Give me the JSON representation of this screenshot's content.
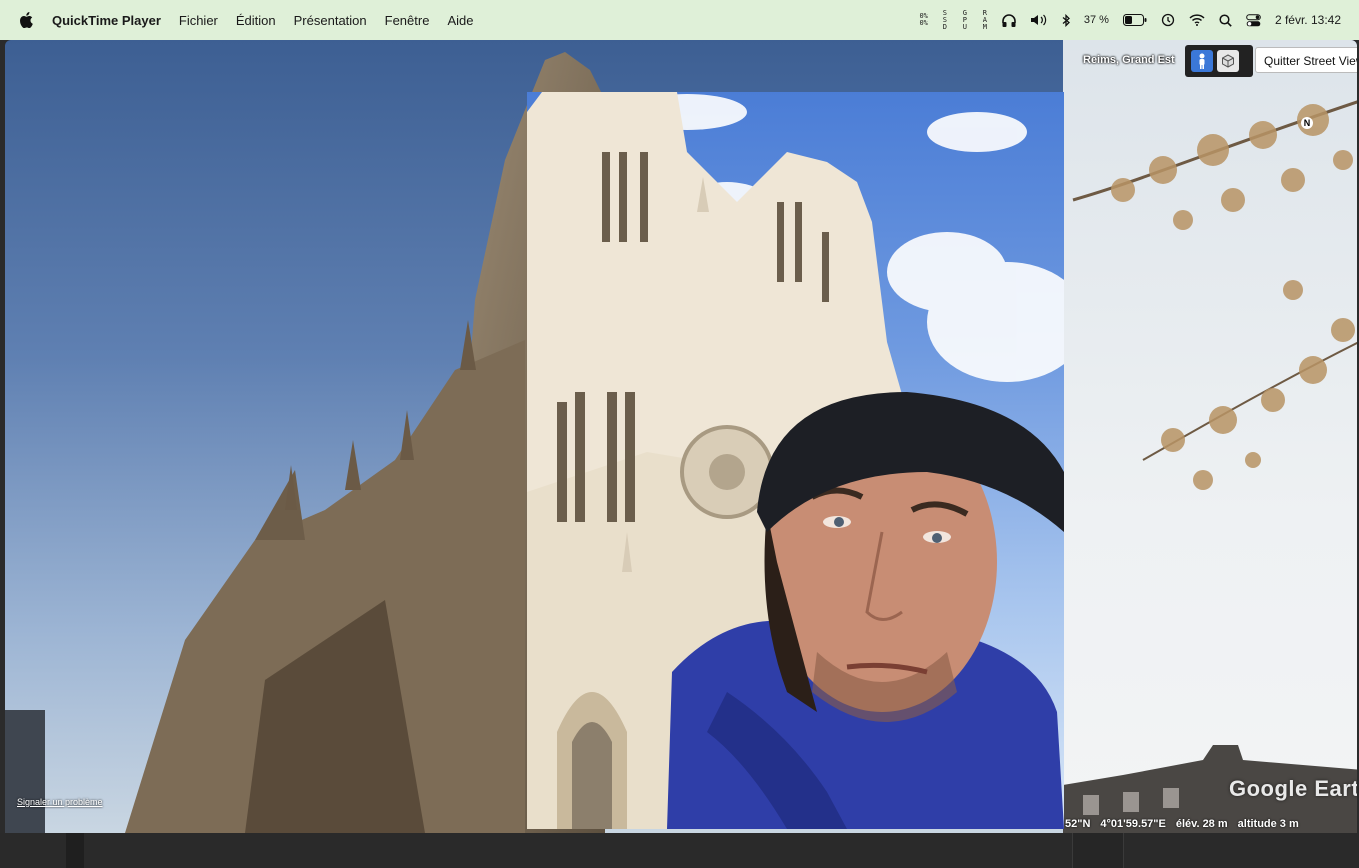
{
  "menubar": {
    "app_name": "QuickTime Player",
    "menus": [
      "Fichier",
      "Édition",
      "Présentation",
      "Fenêtre",
      "Aide"
    ],
    "status": {
      "cpu_top": "0%",
      "cpu_bottom": "0%",
      "ssd_label": "SSD",
      "gpu_label": "GPU",
      "ram_label": "RAM",
      "battery_percent": "37 %",
      "date_time": "2 févr. 13:42"
    },
    "icons": [
      "apple-icon",
      "headphones-icon",
      "volume-icon",
      "bluetooth-icon",
      "battery-icon",
      "time-machine-icon",
      "wifi-icon",
      "search-icon",
      "control-center-icon"
    ]
  },
  "street_view": {
    "location": "Reims, Grand Est",
    "exit_label": "Quitter Street View",
    "compass_letter": "N",
    "report_link": "Signaler un problème",
    "logo": "Google Earth",
    "coordinates": {
      "lat_fragment": "52\"N",
      "lon": "4°01'59.57\"E",
      "elevation": "élév.  28 m",
      "altitude": "altitude  3 m"
    }
  }
}
